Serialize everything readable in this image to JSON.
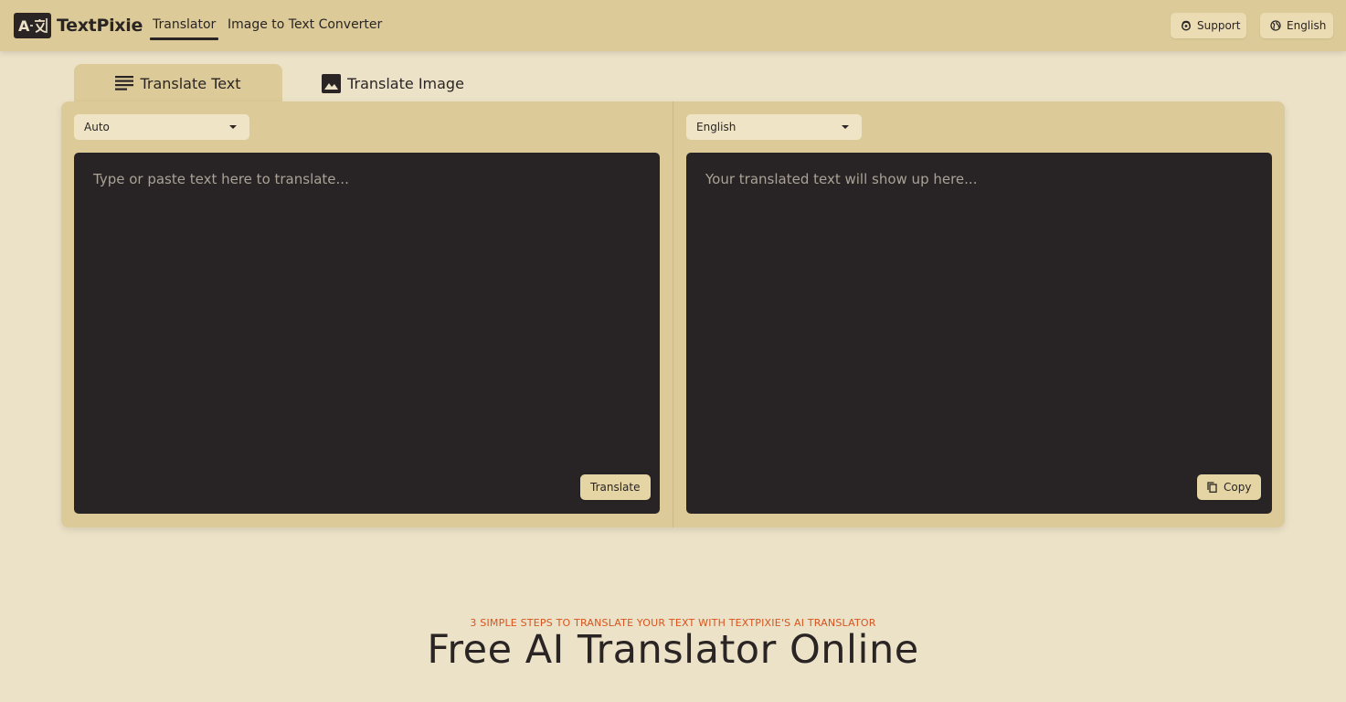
{
  "header": {
    "brand": "TextPixie",
    "logo_mark": "A文",
    "nav": [
      {
        "label": "Translator",
        "active": true
      },
      {
        "label": "Image to Text Converter",
        "active": false
      }
    ],
    "support_label": "Support",
    "support_icon": "support-icon",
    "language_label": "English",
    "language_icon": "globe-icon"
  },
  "tabs": [
    {
      "label": "Translate Text",
      "icon": "text-lines-icon",
      "active": true
    },
    {
      "label": "Translate Image",
      "icon": "image-icon",
      "active": false
    }
  ],
  "translator": {
    "source_language": "Auto",
    "target_language": "English",
    "input_placeholder": "Type or paste text here to translate...",
    "input_value": "",
    "output_placeholder": "Your translated text will show up here...",
    "translate_button": "Translate",
    "copy_button": "Copy",
    "copy_icon": "copy-icon"
  },
  "steps_section": {
    "eyebrow": "3 SIMPLE STEPS TO TRANSLATE YOUR TEXT WITH TEXTPIXIE'S AI TRANSLATOR",
    "title": "Free AI Translator Online"
  },
  "colors": {
    "background": "#ece2c8",
    "header": "#dccb98",
    "panel": "#dccb98",
    "textbox": "#282425",
    "accent_orange": "#d9541e",
    "text_dark": "#2a2524"
  }
}
